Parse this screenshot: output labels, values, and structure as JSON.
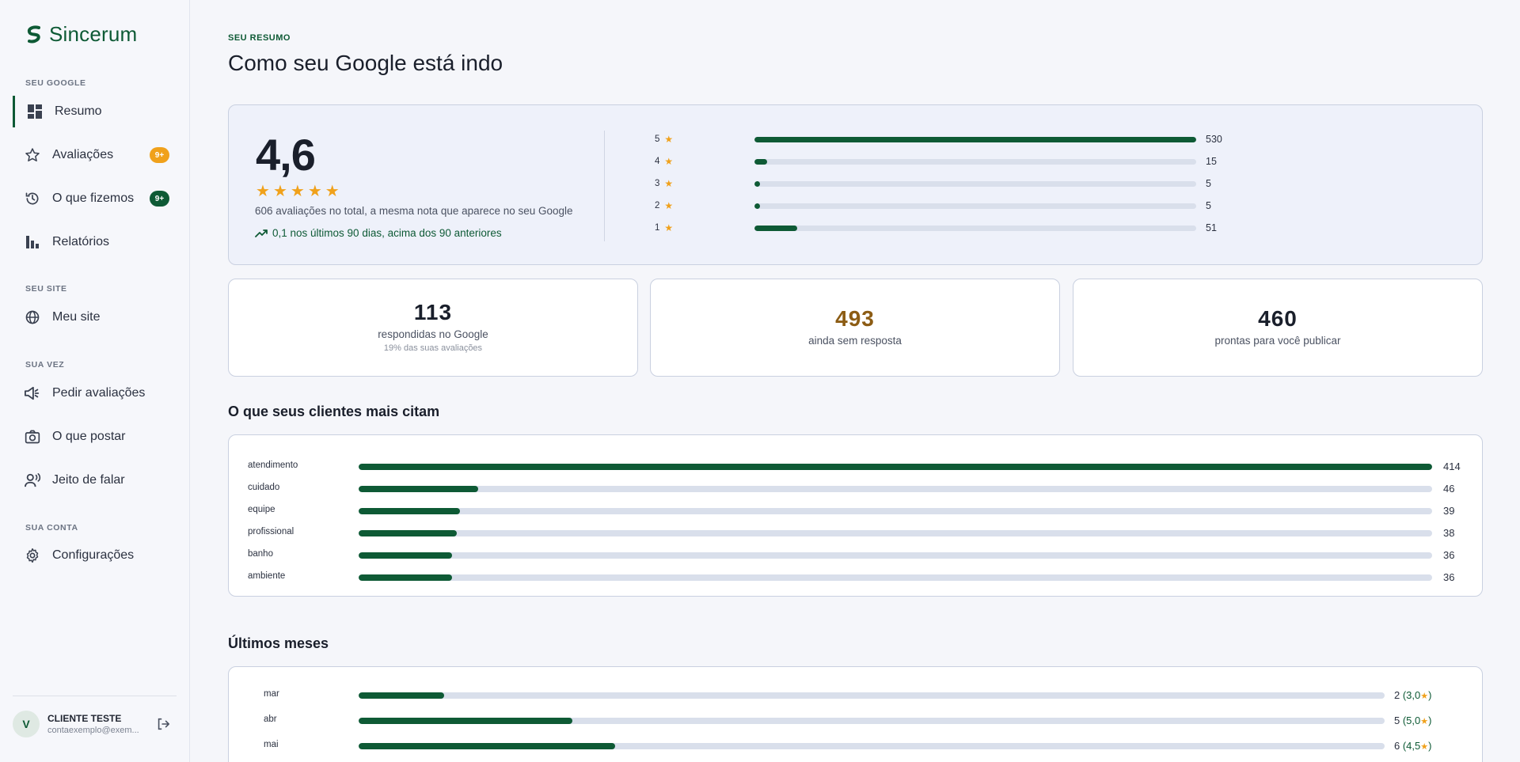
{
  "brand": {
    "name": "Sincerum",
    "color": "#0e5a35"
  },
  "sidebar": {
    "sections": [
      {
        "title": "SEU GOOGLE"
      },
      {
        "title": "SEU SITE"
      },
      {
        "title": "SUA VEZ"
      },
      {
        "title": "SUA CONTA"
      }
    ],
    "items": [
      {
        "label": "Resumo",
        "icon": "dashboard-icon",
        "active": true
      },
      {
        "label": "Avaliações",
        "icon": "star-icon",
        "badge": "9+",
        "badge_color": "#f0a11b"
      },
      {
        "label": "O que fizemos",
        "icon": "history-icon",
        "badge": "9+",
        "badge_color": "#0e5a35"
      },
      {
        "label": "Relatórios",
        "icon": "bar-chart-icon"
      },
      {
        "label": "Meu site",
        "icon": "globe-icon"
      },
      {
        "label": "Pedir avaliações",
        "icon": "megaphone-icon"
      },
      {
        "label": "O que postar",
        "icon": "camera-icon"
      },
      {
        "label": "Jeito de falar",
        "icon": "voice-icon"
      },
      {
        "label": "Configurações",
        "icon": "gear-icon"
      }
    ],
    "user": {
      "initial": "V",
      "name": "CLIENTE TESTE",
      "email": "contaexemplo@exem..."
    }
  },
  "header": {
    "eyebrow": "SEU RESUMO",
    "title": "Como seu Google está indo"
  },
  "rating": {
    "value": "4,6",
    "stars": 5,
    "note": "606 avaliações no total, a mesma nota que aparece no seu Google",
    "trend": "0,1 nos últimos 90 dias, acima dos 90 anteriores",
    "distribution": [
      {
        "stars": "5",
        "count": 530
      },
      {
        "stars": "4",
        "count": 15
      },
      {
        "stars": "3",
        "count": 5
      },
      {
        "stars": "2",
        "count": 5
      },
      {
        "stars": "1",
        "count": 51
      }
    ]
  },
  "stats": [
    {
      "value": "113",
      "label": "respondidas no Google",
      "sub": "19% das suas avaliações"
    },
    {
      "value": "493",
      "label": "ainda sem resposta"
    },
    {
      "value": "460",
      "label": "prontas para você publicar"
    }
  ],
  "topics": {
    "title": "O que seus clientes mais citam",
    "items": [
      {
        "label": "atendimento",
        "count": 414
      },
      {
        "label": "cuidado",
        "count": 46
      },
      {
        "label": "equipe",
        "count": 39
      },
      {
        "label": "profissional",
        "count": 38
      },
      {
        "label": "banho",
        "count": 36
      },
      {
        "label": "ambiente",
        "count": 36
      }
    ]
  },
  "months": {
    "title": "Últimos meses",
    "items": [
      {
        "label": "mar",
        "count": 2,
        "rating": "3,0",
        "fraction": 0.083
      },
      {
        "label": "abr",
        "count": 5,
        "rating": "5,0",
        "fraction": 0.208
      },
      {
        "label": "mai",
        "count": 6,
        "rating": "4,5",
        "fraction": 0.25
      }
    ]
  }
}
